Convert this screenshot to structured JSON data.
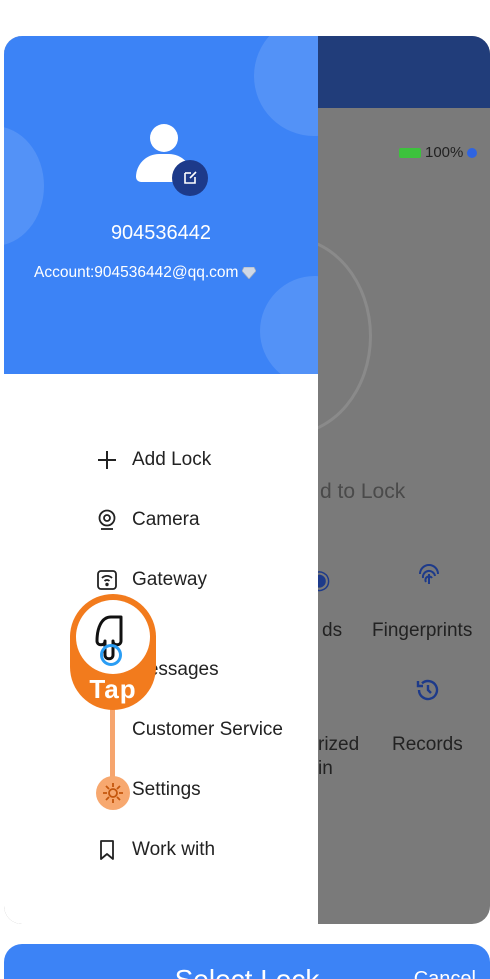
{
  "background_app": {
    "battery": "100%",
    "hint": "d to Lock",
    "tiles": [
      {
        "label": "ds"
      },
      {
        "label": "Fingerprints",
        "icon": "fingerprint-icon"
      },
      {
        "label": "rized"
      },
      {
        "label": "Records",
        "icon": "history-icon"
      },
      {
        "label": "in"
      }
    ]
  },
  "drawer": {
    "username": "904536442",
    "account": "Account:904536442@qq.com",
    "menu": [
      {
        "label": "Add Lock",
        "icon": "plus-icon"
      },
      {
        "label": "Camera",
        "icon": "camera-icon"
      },
      {
        "label": "Gateway",
        "icon": "gateway-icon"
      },
      {
        "label": "Messages",
        "icon": "message-icon"
      },
      {
        "label": "Customer Service",
        "icon": "headset-icon"
      },
      {
        "label": "Settings",
        "icon": "gear-icon"
      },
      {
        "label": "Work with",
        "icon": "bookmark-icon"
      }
    ]
  },
  "tap_hint": {
    "label": "Tap"
  },
  "next_screen": {
    "title": "Select Lock",
    "cancel": "Cancel"
  },
  "colors": {
    "accent": "#3c83f6",
    "header_dark": "#213d7a",
    "tap_orange": "#f27b1d"
  }
}
